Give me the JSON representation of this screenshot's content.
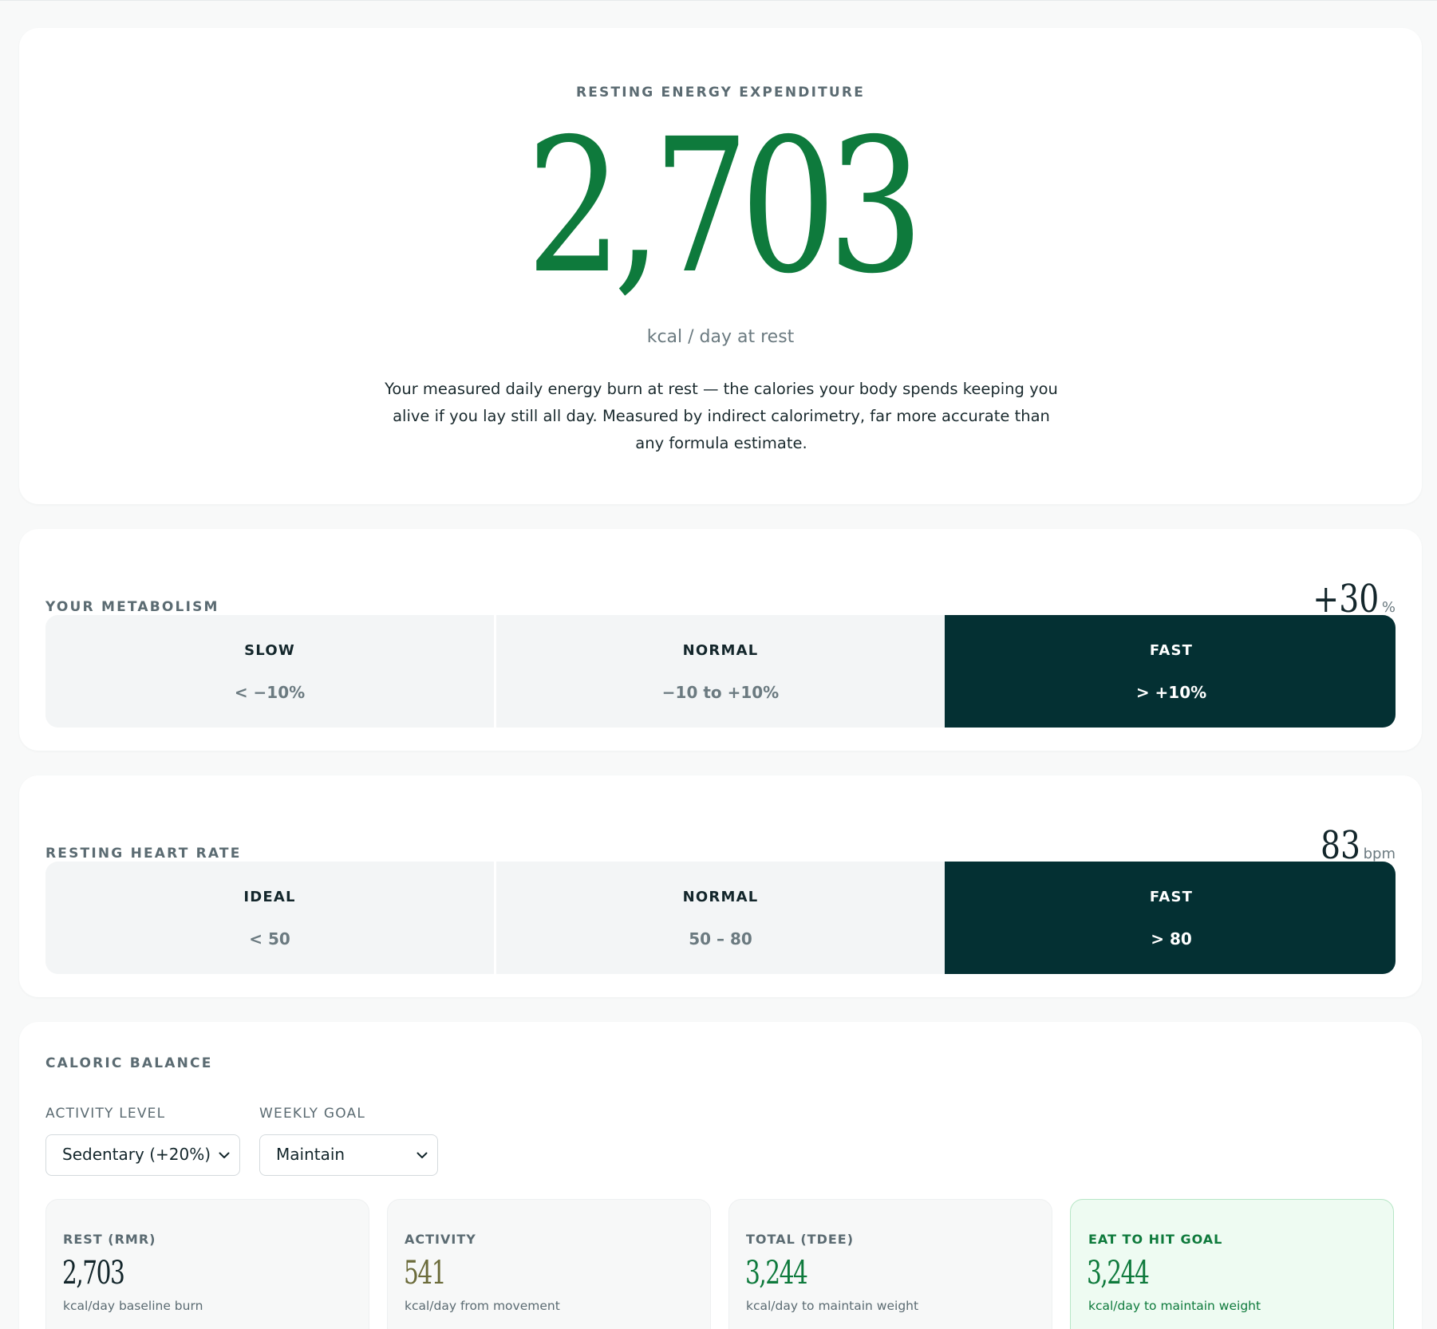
{
  "hero": {
    "eyebrow": "RESTING ENERGY EXPENDITURE",
    "value": "2,703",
    "unit": "kcal / day at rest",
    "description": "Your measured daily energy burn at rest — the calories your body spends keeping you alive if you lay still all day. Measured by indirect calorimetry, far more accurate than any formula estimate.",
    "accent_color": "#0e7a3c"
  },
  "metabolism": {
    "title": "YOUR METABOLISM",
    "value": "+30",
    "suffix": "%",
    "segments": [
      {
        "label": "SLOW",
        "range": "< −10%",
        "active": false
      },
      {
        "label": "NORMAL",
        "range": "−10 to +10%",
        "active": false
      },
      {
        "label": "FAST",
        "range": "> +10%",
        "active": true
      }
    ]
  },
  "heart_rate": {
    "title": "RESTING HEART RATE",
    "value": "83",
    "suffix": "bpm",
    "segments": [
      {
        "label": "IDEAL",
        "range": "< 50",
        "active": false
      },
      {
        "label": "NORMAL",
        "range": "50 – 80",
        "active": false
      },
      {
        "label": "FAST",
        "range": "> 80",
        "active": true
      }
    ]
  },
  "caloric_balance": {
    "title": "CALORIC BALANCE",
    "activity_level": {
      "label": "ACTIVITY LEVEL",
      "selected": "Sedentary (+20%)"
    },
    "weekly_goal": {
      "label": "WEEKLY GOAL",
      "selected": "Maintain"
    },
    "stats": [
      {
        "label": "REST (RMR)",
        "value": "2,703",
        "caption": "kcal/day baseline burn"
      },
      {
        "label": "ACTIVITY",
        "value": "541",
        "caption": "kcal/day from movement"
      },
      {
        "label": "TOTAL (TDEE)",
        "value": "3,244",
        "caption": "kcal/day to maintain weight"
      },
      {
        "label": "EAT TO HIT GOAL",
        "value": "3,244",
        "caption": "kcal/day to maintain weight"
      }
    ]
  },
  "colors": {
    "active_segment": "#043033",
    "goal_background": "#eefbf2",
    "goal_border": "#b7e6c6",
    "activity_value": "#6b6b3a"
  },
  "icons": {
    "select_chevron": "chevron-down-icon"
  }
}
